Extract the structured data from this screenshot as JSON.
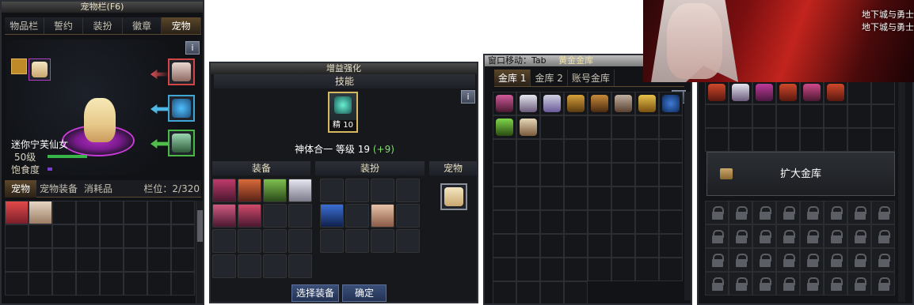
{
  "pet_inventory": {
    "title": "宠物栏(F6)",
    "tabs": [
      "物品栏",
      "誓约",
      "装扮",
      "徽章",
      "宠物"
    ],
    "info": "i",
    "pet_name": "迷你宁芙仙女",
    "pet_level": "50级",
    "satiety_label": "饱食度",
    "bottom_tabs": [
      "宠物",
      "宠物装备",
      "消耗品"
    ],
    "slots_label": "栏位：2/320"
  },
  "skill_panel": {
    "title": "增益强化",
    "skills_header": "技能",
    "skill_badge": "精 10",
    "synergy_text": "神体合一 等级 19",
    "synergy_bonus": "(+9)",
    "col_equip": "装备",
    "col_avatar": "装扮",
    "col_pet": "宠物",
    "select_button": "选择装备",
    "confirm_button": "确定",
    "info": "i"
  },
  "gold_storage": {
    "top_text": "窗口移动：Tab",
    "title": "黄金金库",
    "tabs": [
      "金库 1",
      "金库 2",
      "账号金库"
    ],
    "info": "i"
  },
  "account_storage": {
    "expand_button": "扩大金库"
  },
  "banner": {
    "logo_1": "地下城与勇士",
    "logo_2": "地下城与勇士"
  },
  "colors": {
    "accent": "#5b472a",
    "highlight_purple": "#c83bd8",
    "bonus_green": "#7ee06b"
  }
}
